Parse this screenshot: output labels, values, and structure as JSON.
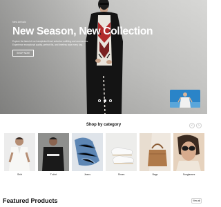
{
  "hero": {
    "kicker": "New Arrivals",
    "title": "New Season, New Collection",
    "description": "Explore the latest of our handpicked fresh selection outfitting and accessories. Experience exceptional quality, perfect fits, and timeless style every day.",
    "button_label": "SHOP NOW",
    "slide_count": 3,
    "active_slide": 2
  },
  "categories": {
    "title": "Shop by category",
    "prev_icon": "‹",
    "next_icon": "›",
    "items": [
      {
        "label": "Shirt"
      },
      {
        "label": "T-shirt"
      },
      {
        "label": "Jeans"
      },
      {
        "label": "Shoes"
      },
      {
        "label": "Bags"
      },
      {
        "label": "Sunglasses"
      }
    ]
  },
  "featured": {
    "title": "Featured Products",
    "view_all_label": "View all"
  }
}
